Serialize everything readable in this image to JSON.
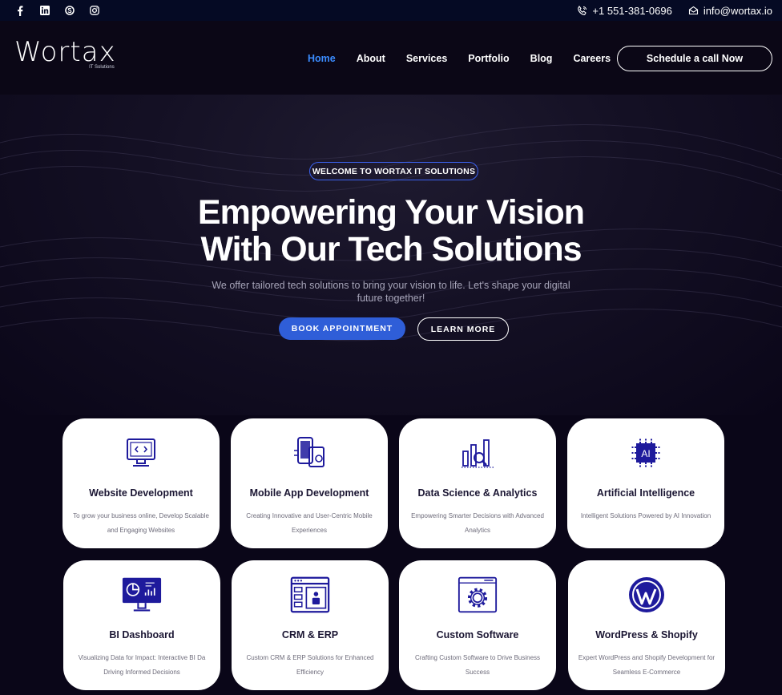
{
  "topbar": {
    "social": [
      "facebook-icon",
      "linkedin-icon",
      "skype-icon",
      "instagram-icon"
    ],
    "phone": "+1 551-381-0696",
    "email": "info@wortax.io"
  },
  "header": {
    "logo_word": "Wortax",
    "logo_tag": "IT Solutions",
    "nav": [
      {
        "label": "Home",
        "active": true
      },
      {
        "label": "About"
      },
      {
        "label": "Services"
      },
      {
        "label": "Portfolio"
      },
      {
        "label": "Blog"
      },
      {
        "label": "Careers"
      }
    ],
    "cta": "Schedule a call Now"
  },
  "hero": {
    "badge": "WELCOME TO WORTAX IT SOLUTIONS",
    "headline_line1": "Empowering Your Vision",
    "headline_line2": "With Our Tech Solutions",
    "subtitle": "We offer tailored tech solutions to bring your vision to life. Let's shape your digital future together!",
    "book_label": "BOOK APPOINTMENT",
    "learn_label": "LEARN MORE"
  },
  "services": [
    {
      "title": "Website Development",
      "desc": "To grow your business online, Develop Scalable and Engaging Websites",
      "icon": "monitor-code-icon"
    },
    {
      "title": "Mobile App Development",
      "desc": "Creating Innovative and User-Centric Mobile Experiences",
      "icon": "mobile-app-icon"
    },
    {
      "title": "Data Science & Analytics",
      "desc": "Empowering Smarter Decisions with Advanced Analytics",
      "icon": "analytics-icon"
    },
    {
      "title": "Artificial Intelligence",
      "desc": "Intelligent Solutions Powered by AI Innovation",
      "icon": "ai-chip-icon"
    },
    {
      "title": "BI Dashboard",
      "desc": "Visualizing Data for Impact: Interactive BI Da Driving Informed Decisions",
      "icon": "dashboard-icon"
    },
    {
      "title": "CRM & ERP",
      "desc": "Custom CRM & ERP Solutions for Enhanced Efficiency",
      "icon": "crm-erp-icon"
    },
    {
      "title": "Custom Software",
      "desc": "Crafting Custom Software to Drive Business Success",
      "icon": "gear-window-icon"
    },
    {
      "title": "WordPress & Shopify",
      "desc": "Expert WordPress and Shopify Development for Seamless E-Commerce",
      "icon": "wordpress-icon"
    }
  ],
  "colors": {
    "accent": "#3b8cff",
    "button": "#2f5ed8",
    "icon": "#1e1a9c",
    "background": "#0a0618"
  }
}
